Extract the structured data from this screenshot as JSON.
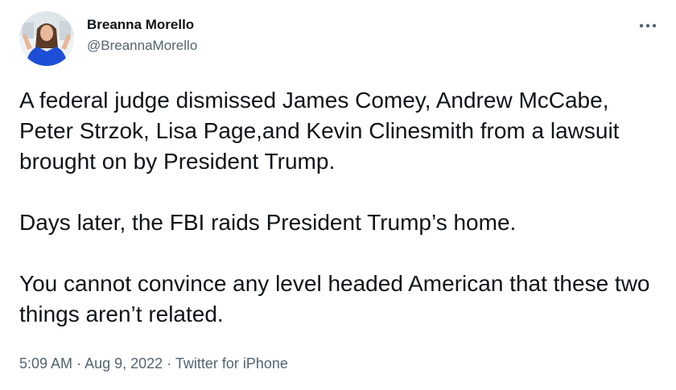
{
  "author": {
    "display_name": "Breanna Morello",
    "handle": "@BreannaMorello"
  },
  "tweet": {
    "paragraphs": [
      "A federal judge dismissed James Comey, Andrew McCabe, Peter Strzok, Lisa Page,and Kevin Clinesmith from a lawsuit brought on by President Trump.",
      "Days later, the FBI raids President Trump’s home.",
      "You cannot convince any level headed American that these two things aren’t related."
    ],
    "time": "5:09 AM",
    "separator": "·",
    "date": "Aug 9, 2022",
    "source": "Twitter for iPhone"
  },
  "icons": {
    "more": "more-horizontal-icon"
  },
  "colors": {
    "text": "#0f1419",
    "secondary": "#536471",
    "background": "#ffffff"
  }
}
